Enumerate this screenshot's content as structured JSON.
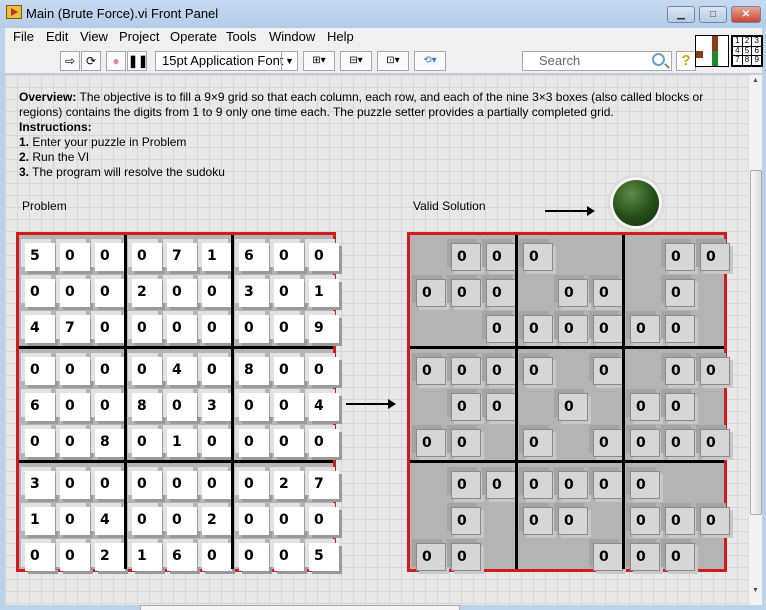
{
  "window": {
    "title": "Main (Brute Force).vi Front Panel",
    "buttons": [
      "minimize",
      "maximize",
      "close"
    ]
  },
  "menu": [
    "File",
    "Edit",
    "View",
    "Project",
    "Operate",
    "Tools",
    "Window",
    "Help"
  ],
  "toolbar": {
    "font": "15pt Application Font",
    "search_placeholder": "Search",
    "help": "?"
  },
  "connector_numbers": [
    "1",
    "2",
    "3",
    "4",
    "5",
    "6",
    "7",
    "8",
    "9"
  ],
  "description": {
    "overview_label": "Overview:",
    "overview": " The objective is to fill a 9×9 grid so that each column, each row, and each of the nine 3×3 boxes (also called blocks or regions) contains the digits from 1 to 9 only one time each. The puzzle setter provides a partially completed grid.",
    "instructions_label": "Instructions:",
    "steps": [
      {
        "n": "1.",
        "t": " Enter your puzzle in Problem"
      },
      {
        "n": "2.",
        "t": " Run the VI"
      },
      {
        "n": "3.",
        "t": " The program will resolve the sudoku"
      }
    ]
  },
  "labels": {
    "problem": "Problem",
    "solution": "Valid Solution"
  },
  "led": {
    "state": "off",
    "color": "#2c5a1f"
  },
  "problem": [
    [
      5,
      0,
      0,
      0,
      7,
      1,
      6,
      0,
      0
    ],
    [
      0,
      0,
      0,
      2,
      0,
      0,
      3,
      0,
      1
    ],
    [
      4,
      7,
      0,
      0,
      0,
      0,
      0,
      0,
      9
    ],
    [
      0,
      0,
      0,
      0,
      4,
      0,
      8,
      0,
      0
    ],
    [
      6,
      0,
      0,
      8,
      0,
      3,
      0,
      0,
      4
    ],
    [
      0,
      0,
      8,
      0,
      1,
      0,
      0,
      0,
      0
    ],
    [
      3,
      0,
      0,
      0,
      0,
      0,
      0,
      2,
      7
    ],
    [
      1,
      0,
      4,
      0,
      0,
      2,
      0,
      0,
      0
    ],
    [
      0,
      0,
      2,
      1,
      6,
      0,
      0,
      0,
      5
    ]
  ],
  "solution": [
    [
      null,
      0,
      0,
      0,
      null,
      null,
      null,
      0,
      0
    ],
    [
      0,
      0,
      0,
      null,
      0,
      0,
      null,
      0,
      null
    ],
    [
      null,
      null,
      0,
      0,
      0,
      0,
      0,
      0,
      null
    ],
    [
      0,
      0,
      0,
      0,
      null,
      0,
      null,
      0,
      0
    ],
    [
      null,
      0,
      0,
      null,
      0,
      null,
      0,
      0,
      null
    ],
    [
      0,
      0,
      null,
      0,
      null,
      0,
      0,
      0,
      0
    ],
    [
      null,
      0,
      0,
      0,
      0,
      0,
      0,
      null,
      null
    ],
    [
      null,
      0,
      null,
      0,
      0,
      null,
      0,
      0,
      0
    ],
    [
      0,
      0,
      null,
      null,
      null,
      0,
      0,
      0,
      null
    ]
  ]
}
